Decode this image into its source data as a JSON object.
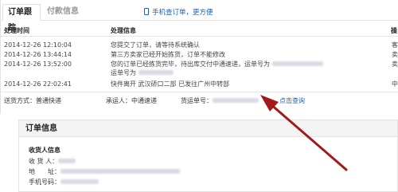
{
  "tabs": [
    {
      "label": "订单跟踪"
    },
    {
      "label": "付款信息"
    }
  ],
  "mobile_link": "手机查订单，更方便",
  "table_headers": {
    "time": "处理时间",
    "info": "处理信息",
    "extra": "操"
  },
  "rows": [
    {
      "time": "2014-12-26 12:10:04",
      "info": "您提交了订单，请等待系统确认",
      "extra": "客"
    },
    {
      "time": "2014-12-26 13:44:14",
      "info": "第三方卖家已经开始拣货，订单不能修改",
      "extra": "卖"
    },
    {
      "time": "2014-12-26 13:52:00",
      "info": "您的订单已经拣货完毕，待出库交付中通速递，运单号为",
      "extra": "卖"
    },
    {
      "time": "",
      "info": "运单号为",
      "extra": ""
    },
    {
      "time": "2014-12-26 22:02:41",
      "info": "快件离开 武汉硚口二部 已发往广州中转部",
      "extra": "中"
    }
  ],
  "shipping": {
    "method": "送货方式：普通快递",
    "carrier": "承运人：中通速递",
    "tracking_label": "货运单号：",
    "query_link": "点击查询"
  },
  "order_info": {
    "title": "订单信息",
    "receiver_title": "收货人信息",
    "fields": [
      {
        "label": "收 货 人："
      },
      {
        "label": "地　　址："
      },
      {
        "label": "手机号码："
      }
    ]
  },
  "colors": {
    "link": "#1b61b8",
    "arrow": "#a3191b"
  },
  "icons": {
    "mobile": "phone-icon"
  }
}
